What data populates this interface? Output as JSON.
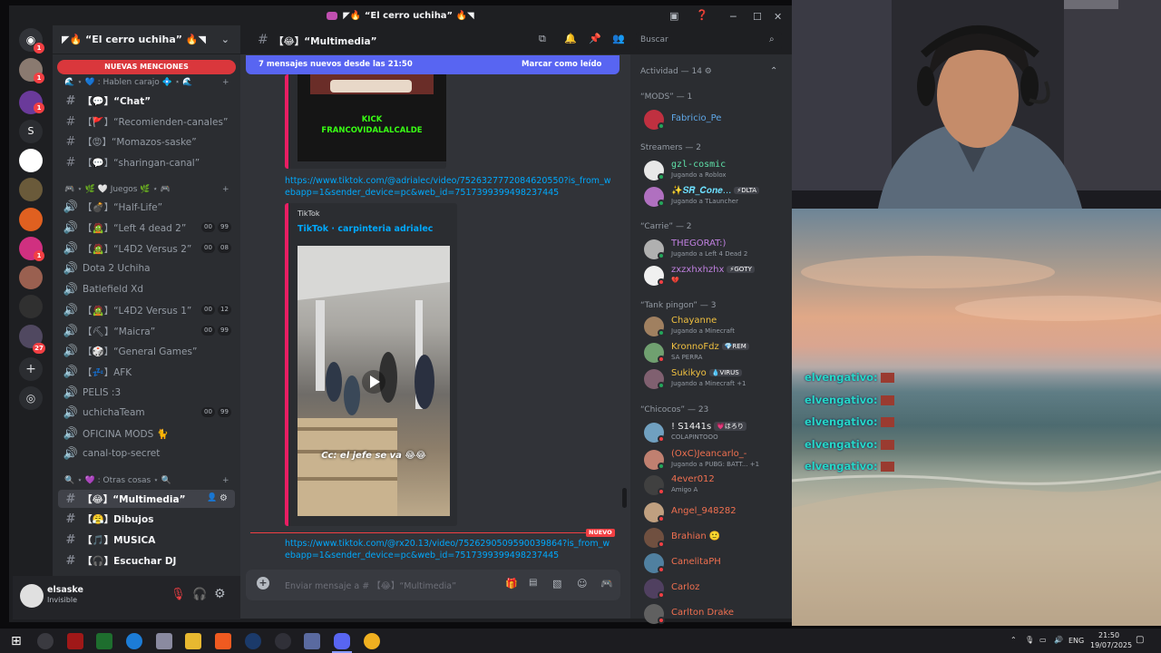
{
  "window": {
    "title": "◤🔥 “El cerro uchiha” 🔥◥"
  },
  "guild": {
    "name": "◤🔥 “El cerro uchiha” 🔥◥",
    "mentions_banner": "NUEVAS MENCIONES"
  },
  "server_badges": [
    "1",
    "1",
    "1",
    "1",
    "27"
  ],
  "categories": [
    {
      "label": "🌊 ⋆ 💙 : Hablen carajo 💠 ⋆ 🌊"
    },
    {
      "label": "🎮 ⋆ 🌿 🤍 Juegos 🌿 ⋆ 🎮"
    },
    {
      "label": "🔍 ⋆ 💜 : Otras cosas ⋆ 🔍"
    }
  ],
  "channels": [
    {
      "icon": "#",
      "label": "【💬】“Chat”",
      "style": "bright"
    },
    {
      "icon": "#",
      "label": "【🚩】“Recomienden-canales”"
    },
    {
      "icon": "#",
      "label": "【😡】“Momazos-saske”"
    },
    {
      "icon": "#",
      "label": "【💬】“sharingan-canal”"
    },
    {
      "icon": "🔊",
      "label": "【💣】“Half-Life”"
    },
    {
      "icon": "🔊",
      "label": "【🧟】“Left 4 dead 2”",
      "pills": [
        "00",
        "99"
      ]
    },
    {
      "icon": "🔊",
      "label": "【🧟】“L4D2 Versus 2”",
      "pills": [
        "00",
        "08"
      ]
    },
    {
      "icon": "🔊",
      "label": "Dota 2 Uchiha"
    },
    {
      "icon": "🔊",
      "label": "Batlefield Xd"
    },
    {
      "icon": "🔊",
      "label": "【🧟】“L4D2 Versus 1”",
      "pills": [
        "00",
        "12"
      ]
    },
    {
      "icon": "🔊",
      "label": "【⛏】“Maicra”",
      "pills": [
        "00",
        "99"
      ]
    },
    {
      "icon": "🔊",
      "label": "【🎲】“General Games”"
    },
    {
      "icon": "🔊",
      "label": "【💤】AFK"
    },
    {
      "icon": "🔊",
      "label": "PELIS :3"
    },
    {
      "icon": "🔊",
      "label": "uchichaTeam",
      "pills": [
        "00",
        "99"
      ]
    },
    {
      "icon": "🔊",
      "label": "OFICINA MODS 🐈"
    },
    {
      "icon": "🔊",
      "label": "canal-top-secret"
    },
    {
      "icon": "#",
      "label": "【😂】“Multimedia”",
      "style": "sel"
    },
    {
      "icon": "#",
      "label": "【😤】Dibujos",
      "style": "bright"
    },
    {
      "icon": "#",
      "label": "【🎵】MUSICA",
      "style": "bright"
    },
    {
      "icon": "#",
      "label": "【🎧】Escuchar DJ",
      "style": "bright"
    }
  ],
  "user": {
    "name": "elsaske",
    "status": "Invisible"
  },
  "header": {
    "channel": "【😂】“Multimedia”",
    "search_placeholder": "Buscar"
  },
  "new_messages": {
    "text": "7 mensajes nuevos desde las 21:50",
    "action": "Marcar como leído"
  },
  "messages": {
    "overlay_text": "KICK FRANCOVIDALALCALDE",
    "link1": "https://www.tiktok.com/@adrialec/video/7526327772084620550?is_from_webapp=1&sender_device=pc&web_id=7517399399498237445",
    "embed_provider": "TikTok",
    "embed_title": "TikTok · carpinteria adrialec",
    "video_caption": "Cc: el jefe se va 😂😂",
    "new_label": "NUEVO",
    "link2": "https://www.tiktok.com/@rx20.13/video/7526290509590039864?is_from_webapp=1&sender_device=pc&web_id=7517399399498237445"
  },
  "composer": {
    "placeholder": "Enviar mensaje a # 【😂】“Multimedia”"
  },
  "members": {
    "activity_header": "Actividad — 14",
    "groups": [
      {
        "title": "“MODS” — 1",
        "members": [
          {
            "name": "Fabricio_Pe",
            "status": "",
            "color": "#5fa8e8",
            "avatar": "#c03040",
            "dot": "#23a55a"
          }
        ]
      },
      {
        "title": "Streamers — 2",
        "members": [
          {
            "name": "gzl-cosmic",
            "status": "Jugando a Roblox",
            "color": "#5fe0a8",
            "avatar": "#e8e8e8",
            "dot": "#23a55a",
            "mono": true
          },
          {
            "name": "✨𝑺𝑹_𝑪𝒐𝒏𝒆...",
            "status": "Jugando a TLauncher",
            "color": "#6ee0ff",
            "avatar": "#b070c0",
            "dot": "#23a55a",
            "tag": "⚡DLTA"
          }
        ]
      },
      {
        "title": "“Carrie” — 2",
        "members": [
          {
            "name": "THEGORAT:)",
            "status": "Jugando a Left 4 Dead 2",
            "color": "#c080e0",
            "avatar": "#b0b0b0",
            "dot": "#23a55a"
          },
          {
            "name": "zxzxhxhzhx",
            "status": "💔",
            "color": "#c080e0",
            "avatar": "#f0f0f0",
            "dot": "#f23f43",
            "tag": "⚡GOTY"
          }
        ]
      },
      {
        "title": "“Tank pingon” — 3",
        "members": [
          {
            "name": "Chayanne",
            "status": "Jugando a Minecraft",
            "color": "#f0c040",
            "avatar": "#a08060",
            "dot": "#23a55a"
          },
          {
            "name": "KronnoFdz",
            "status": "SA PERRA",
            "color": "#f0c040",
            "avatar": "#70a070",
            "dot": "#f23f43",
            "tag": "💎REM"
          },
          {
            "name": "Sukikyo",
            "status": "Jugando a Minecraft +1",
            "color": "#f0c040",
            "avatar": "#806070",
            "dot": "#23a55a",
            "tag": "💧VIRUS"
          }
        ]
      },
      {
        "title": "“Chicocos” — 23",
        "members": [
          {
            "name": "! S1441s",
            "status": "COLAPINTOOO",
            "color": "#f0f0f0",
            "avatar": "#70a0c0",
            "dot": "#f23f43",
            "tag": "💗ほろり"
          },
          {
            "name": "(OxC)Jeancarlo_-",
            "status": "Jugando a PUBG: BATT... +1",
            "color": "#f07050",
            "avatar": "#c08070",
            "dot": "#23a55a"
          },
          {
            "name": "4ever012",
            "status": "Amigo A",
            "color": "#f07050",
            "avatar": "#404040",
            "dot": "#f23f43"
          },
          {
            "name": "Angel_948282",
            "status": "",
            "color": "#f07050",
            "avatar": "#c0a080",
            "dot": "#f23f43"
          },
          {
            "name": "Brahian 🙂",
            "status": "",
            "color": "#f07050",
            "avatar": "#705040",
            "dot": "#f23f43"
          },
          {
            "name": "CanelitaPH",
            "status": "",
            "color": "#f07050",
            "avatar": "#5080a0",
            "dot": "#f23f43"
          },
          {
            "name": "Carloz",
            "status": "",
            "color": "#f07050",
            "avatar": "#504060",
            "dot": "#f23f43"
          },
          {
            "name": "Carlton Drake",
            "status": "",
            "color": "#f07050",
            "avatar": "#606060",
            "dot": "#f23f43"
          }
        ]
      }
    ]
  },
  "stream_chat": [
    "elvengativo:",
    "elvengativo:",
    "elvengativo:",
    "elvengativo:",
    "elvengativo:"
  ],
  "taskbar": {
    "lang": "ENG",
    "time": "21:50",
    "date": "19/07/2025"
  },
  "colors": {
    "blurple": "#5865f2",
    "mention_red": "#da373c",
    "link": "#00a8fc",
    "embed_border": "#e91e63"
  }
}
